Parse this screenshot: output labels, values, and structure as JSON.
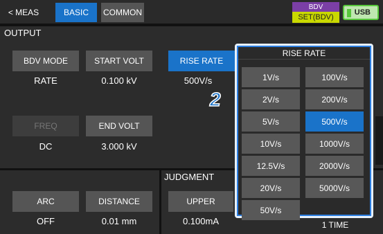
{
  "topbar": {
    "tab_meas": "< MEAS",
    "tab_basic": "BASIC",
    "tab_common": "COMMON",
    "mode_top": "BDV",
    "mode_bottom": "SET(BDV)",
    "usb": "USB"
  },
  "output": {
    "title": "OUTPUT",
    "bdv_mode_label": "BDV MODE",
    "bdv_mode_value": "RATE",
    "start_volt_label": "START VOLT",
    "start_volt_value": "0.100 kV",
    "rise_rate_label": "RISE RATE",
    "rise_rate_value": "500V/s",
    "freq_label": "FREQ",
    "freq_value": "DC",
    "end_volt_label": "END VOLT",
    "end_volt_value": "3.000 kV"
  },
  "bottom": {
    "arc_label": "ARC",
    "arc_value": "OFF",
    "distance_label": "DISTANCE",
    "distance_value": "0.01 mm",
    "judgment_title": "JUDGMENT",
    "upper_label": "UPPER",
    "upper_value": "0.100mA",
    "partial_value": "1 TIME"
  },
  "popup": {
    "title": "RISE RATE",
    "options": [
      "1V/s",
      "100V/s",
      "2V/s",
      "200V/s",
      "5V/s",
      "500V/s",
      "10V/s",
      "1000V/s",
      "12.5V/s",
      "2000V/s",
      "20V/s",
      "5000V/s",
      "50V/s"
    ],
    "selected": "500V/s"
  },
  "callout": "2"
}
